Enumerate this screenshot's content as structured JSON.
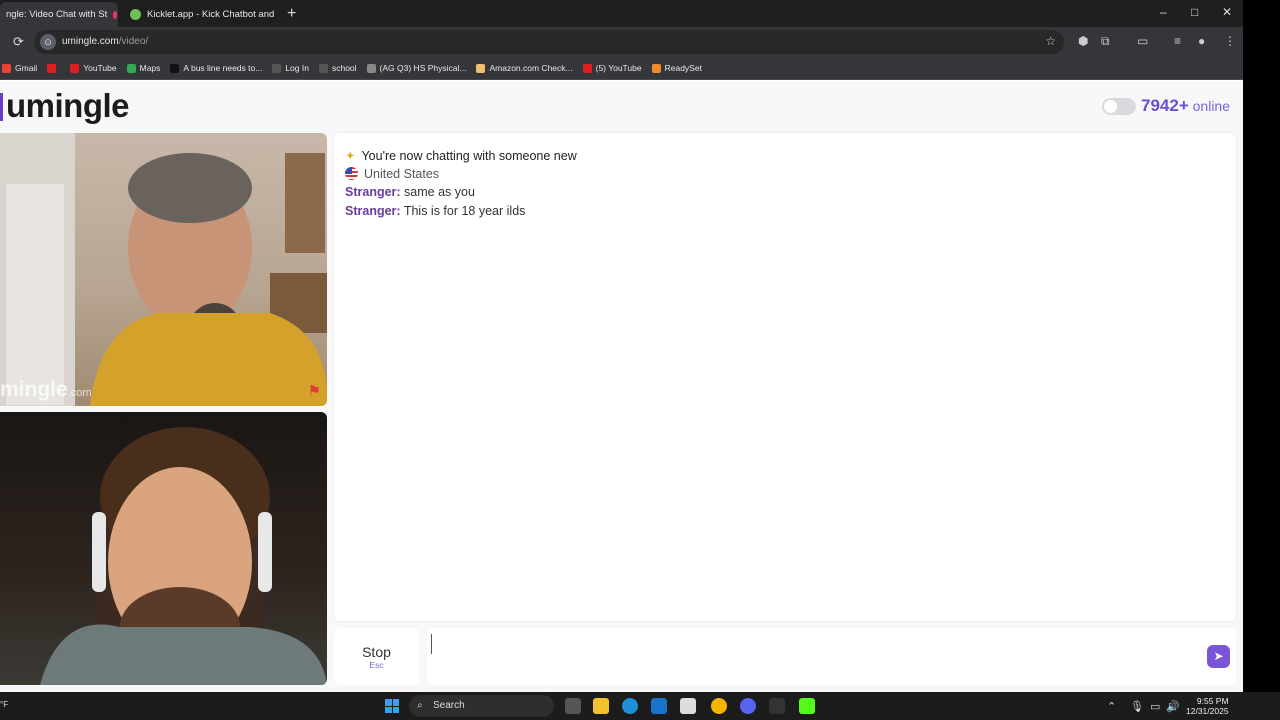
{
  "browser": {
    "tabs": [
      {
        "label": "ngle: Video Chat with St",
        "active": true
      },
      {
        "label": "Kicklet.app - Kick Chatbot and",
        "active": false
      }
    ],
    "new_tab": "+",
    "window_controls": {
      "minimize": "–",
      "maximize": "□",
      "close": "✕"
    },
    "url_host": "umingle.com",
    "url_path": "/video/",
    "bookmarks": [
      {
        "label": "Gmail",
        "color": "#ea4335"
      },
      {
        "label": "",
        "color": "#e02020"
      },
      {
        "label": "YouTube",
        "color": "#e02020"
      },
      {
        "label": "Maps",
        "color": "#34a853"
      },
      {
        "label": "A bus line needs to...",
        "color": "#111111"
      },
      {
        "label": "Log In",
        "color": "#555555"
      },
      {
        "label": "school",
        "color": "#555555"
      },
      {
        "label": "(AG Q3) HS Physical...",
        "color": "#888888"
      },
      {
        "label": "Amazon.com Check...",
        "color": "#f0c070"
      },
      {
        "label": "(5) YouTube",
        "color": "#e02020"
      },
      {
        "label": "ReadySet",
        "color": "#f08a2a"
      }
    ]
  },
  "site": {
    "logo": "umingle",
    "online_count": "7942+",
    "online_label": " online",
    "video_watermark": "mingle",
    "video_watermark_suffix": ".com"
  },
  "chat": {
    "system_message": "You're now chatting with someone new",
    "country": "United States",
    "messages": [
      {
        "sender": "Stranger:",
        "text": " same as you"
      },
      {
        "sender": "Stranger:",
        "text": " This is for 18 year ilds"
      }
    ],
    "input_value": "",
    "input_placeholder": ""
  },
  "controls": {
    "stop_label": "Stop",
    "stop_hint": "Esc",
    "send_icon": "send-icon"
  },
  "taskbar": {
    "search_label": "Search",
    "time": "9:55 PM",
    "date": "12/31/2025",
    "left_text": "°F"
  },
  "colors": {
    "accent": "#6a4fd0",
    "sender": "#6b3a9e",
    "flag": "#e03a3a"
  }
}
